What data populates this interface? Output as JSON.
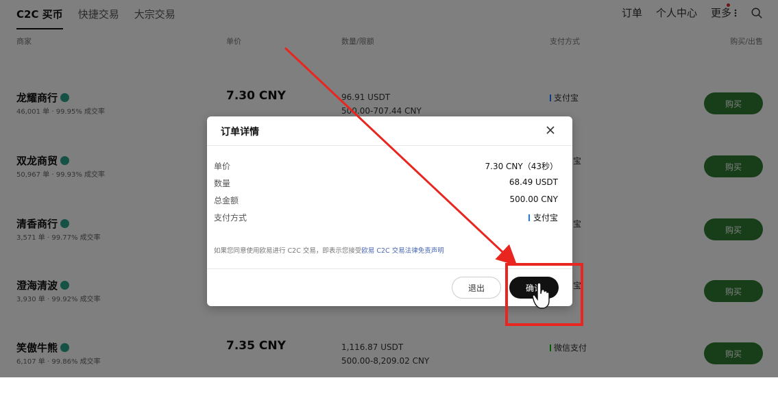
{
  "nav": {
    "tabs": [
      {
        "label": "C2C 买币",
        "active": true
      },
      {
        "label": "快捷交易",
        "active": false
      },
      {
        "label": "大宗交易",
        "active": false
      }
    ],
    "right": {
      "orders": "订单",
      "profile": "个人中心",
      "more": "更多"
    }
  },
  "columns": {
    "merchant": "商家",
    "price": "单价",
    "quantity": "数量/限额",
    "payment": "支付方式",
    "action": "购买/出售"
  },
  "merchants": [
    {
      "name": "龙耀商行",
      "stats": "46,001 单 · 99.95% 成交率",
      "price": "7.30 CNY",
      "qty": "96.91 USDT",
      "limit": "500.00-707.44 CNY",
      "payment": "支付宝",
      "action": "购买"
    },
    {
      "name": "双龙商贸",
      "stats": "50,967 单 · 99.93% 成交率",
      "price": "",
      "qty": "",
      "limit": "",
      "payment": "宝",
      "action": "购买"
    },
    {
      "name": "清香商行",
      "stats": "3,571 单 · 99.77% 成交率",
      "price": "",
      "qty": "",
      "limit": "",
      "payment": "宝",
      "action": "购买"
    },
    {
      "name": "澄海清波",
      "stats": "3,930 单 · 99.92% 成交率",
      "price": "",
      "qty": "",
      "limit": "",
      "payment": "宝",
      "action": "购买"
    },
    {
      "name": "笑傲牛熊",
      "stats": "6,107 单 · 99.86% 成交率",
      "price": "7.35 CNY",
      "qty": "1,116.87 USDT",
      "limit": "500.00-8,209.02 CNY",
      "payment": "微信支付",
      "action": "购买"
    }
  ],
  "modal": {
    "title": "订单详情",
    "details": [
      {
        "label": "单价",
        "value": "7.30 CNY（43秒）"
      },
      {
        "label": "数量",
        "value": "68.49 USDT"
      },
      {
        "label": "总金额",
        "value": "500.00 CNY"
      },
      {
        "label": "支付方式",
        "value": "支付宝"
      }
    ],
    "disclaimer_prefix": "如果您同意使用欧易进行 C2C 交易，即表示您接受",
    "disclaimer_link": "欧易 C2C 交易法律免责声明",
    "exit_label": "退出",
    "confirm_label": "确认"
  },
  "colors": {
    "buy_green": "#2e7d32",
    "verified_teal": "#2aa58a",
    "alipay_blue": "#1677ff",
    "wechat_green": "#09bb07",
    "confirm_black": "#111111",
    "annotation_red": "#e8251f",
    "notify_red": "#d32f2f"
  }
}
